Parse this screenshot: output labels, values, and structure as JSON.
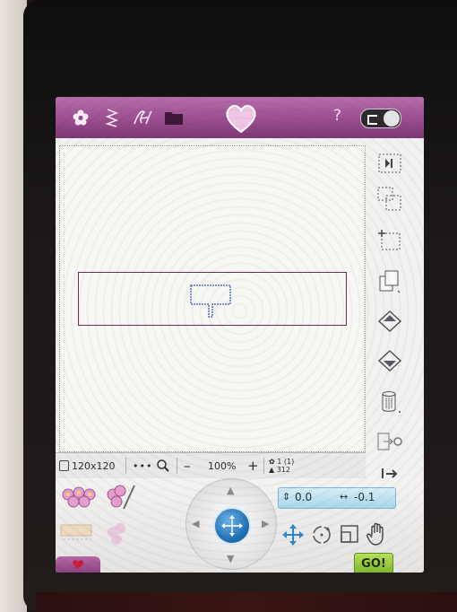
{
  "toolbar": {
    "icons": [
      "flower-icon",
      "stitch-zigzag-icon",
      "script-font-icon",
      "folder-icon",
      "heart-icon"
    ],
    "help_label": "?"
  },
  "status_bar": {
    "hoop_size": "120x120",
    "more_label": "•••",
    "zoom_out_label": "–",
    "zoom_level": "100%",
    "zoom_in_label": "+",
    "design_count": "1 (1)",
    "stitch_count": "312"
  },
  "position": {
    "y_value": "0.0",
    "x_value": "-0.1"
  },
  "go_label": "GO!",
  "colors": {
    "toolbar": "#9b4e90",
    "accent_blue": "#1f6fb4",
    "go_green": "#8fc23a",
    "frame": "#6a2d58"
  }
}
